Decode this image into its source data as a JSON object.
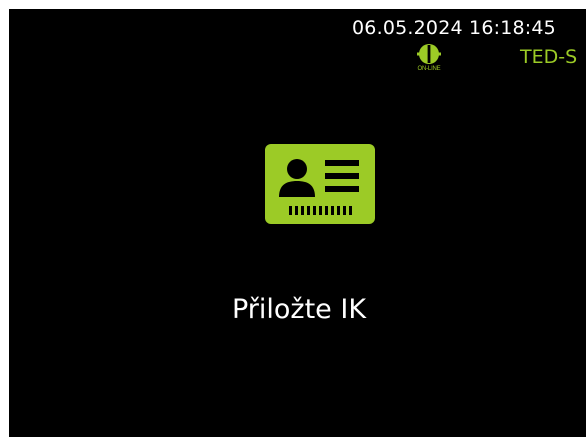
{
  "status_bar": {
    "datetime": "06.05.2024 16:18:45",
    "connection_label": "ON-LINE",
    "device_name": "TED-S"
  },
  "main": {
    "icon": "id-card-icon",
    "prompt": "Přiložte IK"
  },
  "colors": {
    "background": "#000000",
    "accent": "#9ccb26",
    "text": "#ffffff"
  }
}
